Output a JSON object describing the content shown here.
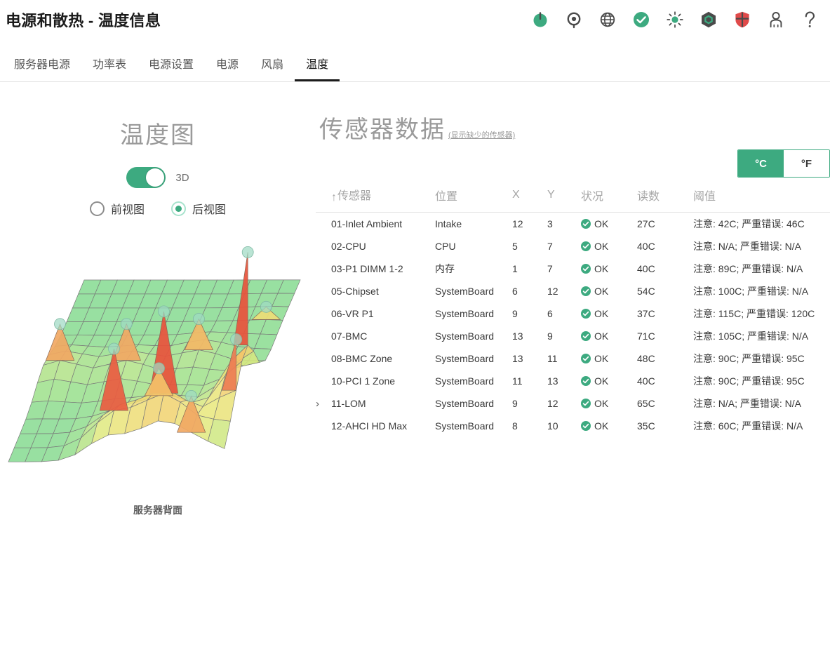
{
  "header": {
    "title": "电源和散热 - 温度信息",
    "icons": [
      {
        "name": "power-icon",
        "label": "电源"
      },
      {
        "name": "location-target-icon",
        "label": "定位"
      },
      {
        "name": "globe-icon",
        "label": "网络"
      },
      {
        "name": "health-check-icon",
        "label": "运行状况"
      },
      {
        "name": "brightness-icon",
        "label": "亮度"
      },
      {
        "name": "hexagon-icon",
        "label": "系统"
      },
      {
        "name": "shield-icon",
        "label": "安全"
      },
      {
        "name": "user-icon",
        "label": "用户"
      },
      {
        "name": "help-icon",
        "label": "帮助"
      }
    ]
  },
  "tabs": [
    {
      "label": "服务器电源",
      "active": false
    },
    {
      "label": "功率表",
      "active": false
    },
    {
      "label": "电源设置",
      "active": false
    },
    {
      "label": "电源",
      "active": false
    },
    {
      "label": "风扇",
      "active": false
    },
    {
      "label": "温度",
      "active": true
    }
  ],
  "left_panel": {
    "title": "温度图",
    "toggle": {
      "label": "3D",
      "on": true
    },
    "views": [
      {
        "label": "前视图",
        "selected": false
      },
      {
        "label": "后视图",
        "selected": true
      }
    ],
    "caption": "服务器背面"
  },
  "sensors_panel": {
    "title": "传感器数据",
    "show_missing_link": "(显示缺少的传感器)",
    "units": [
      {
        "label": "°C",
        "active": true
      },
      {
        "label": "°F",
        "active": false
      }
    ],
    "columns": {
      "sort_arrow": "↑",
      "sensor": "传感器",
      "location": "位置",
      "x": "X",
      "y": "Y",
      "status": "状况",
      "reading": "读数",
      "threshold": "阈值"
    },
    "expand_chevron": "›",
    "rows": [
      {
        "expandable": false,
        "sensor": "01-Inlet Ambient",
        "location": "Intake",
        "x": "12",
        "y": "3",
        "status": "OK",
        "reading": "27C",
        "threshold": "注意: 42C; 严重错误: 46C"
      },
      {
        "expandable": false,
        "sensor": "02-CPU",
        "location": "CPU",
        "x": "5",
        "y": "7",
        "status": "OK",
        "reading": "40C",
        "threshold": "注意: N/A; 严重错误: N/A"
      },
      {
        "expandable": false,
        "sensor": "03-P1 DIMM 1-2",
        "location": "内存",
        "x": "1",
        "y": "7",
        "status": "OK",
        "reading": "40C",
        "threshold": "注意: 89C; 严重错误: N/A"
      },
      {
        "expandable": false,
        "sensor": "05-Chipset",
        "location": "SystemBoard",
        "x": "6",
        "y": "12",
        "status": "OK",
        "reading": "54C",
        "threshold": "注意: 100C; 严重错误: N/A"
      },
      {
        "expandable": false,
        "sensor": "06-VR P1",
        "location": "SystemBoard",
        "x": "9",
        "y": "6",
        "status": "OK",
        "reading": "37C",
        "threshold": "注意: 115C; 严重错误: 120C"
      },
      {
        "expandable": false,
        "sensor": "07-BMC",
        "location": "SystemBoard",
        "x": "13",
        "y": "9",
        "status": "OK",
        "reading": "71C",
        "threshold": "注意: 105C; 严重错误: N/A"
      },
      {
        "expandable": false,
        "sensor": "08-BMC Zone",
        "location": "SystemBoard",
        "x": "13",
        "y": "11",
        "status": "OK",
        "reading": "48C",
        "threshold": "注意: 90C; 严重错误: 95C"
      },
      {
        "expandable": false,
        "sensor": "10-PCI 1 Zone",
        "location": "SystemBoard",
        "x": "11",
        "y": "13",
        "status": "OK",
        "reading": "40C",
        "threshold": "注意: 90C; 严重错误: 95C"
      },
      {
        "expandable": true,
        "sensor": "11-LOM",
        "location": "SystemBoard",
        "x": "9",
        "y": "12",
        "status": "OK",
        "reading": "65C",
        "threshold": "注意: N/A; 严重错误: N/A"
      },
      {
        "expandable": false,
        "sensor": "12-AHCI HD Max",
        "location": "SystemBoard",
        "x": "8",
        "y": "10",
        "status": "OK",
        "reading": "35C",
        "threshold": "注意: 60C; 严重错误: N/A"
      }
    ]
  },
  "colors": {
    "accent_green": "#3daa80",
    "status_ok": "#3daa80",
    "shield_red": "#e04a4a",
    "muted_gray": "#9a9a9a",
    "active_tab": "#1c1c1c"
  },
  "chart_data": {
    "type": "heatmap",
    "title": "温度图",
    "caption": "服务器背面",
    "view": "后视图",
    "mode": "3D",
    "unit": "°C",
    "grid_cols": 14,
    "grid_rows": 14,
    "colorscale": [
      "#5fd39a",
      "#9fe08a",
      "#e8ea7d",
      "#f4c96a",
      "#ef8f5e",
      "#e8523c"
    ],
    "peaks": [
      {
        "sensor": "01-Inlet Ambient",
        "x": 12,
        "y": 3,
        "value": 27
      },
      {
        "sensor": "02-CPU",
        "x": 5,
        "y": 7,
        "value": 40
      },
      {
        "sensor": "03-P1 DIMM 1-2",
        "x": 1,
        "y": 7,
        "value": 40
      },
      {
        "sensor": "05-Chipset",
        "x": 6,
        "y": 12,
        "value": 54
      },
      {
        "sensor": "06-VR P1",
        "x": 9,
        "y": 6,
        "value": 37
      },
      {
        "sensor": "07-BMC",
        "x": 13,
        "y": 9,
        "value": 71
      },
      {
        "sensor": "08-BMC Zone",
        "x": 13,
        "y": 11,
        "value": 48
      },
      {
        "sensor": "10-PCI 1 Zone",
        "x": 11,
        "y": 13,
        "value": 40
      },
      {
        "sensor": "11-LOM",
        "x": 9,
        "y": 12,
        "value": 65
      },
      {
        "sensor": "12-AHCI HD Max",
        "x": 8,
        "y": 10,
        "value": 35
      }
    ]
  }
}
